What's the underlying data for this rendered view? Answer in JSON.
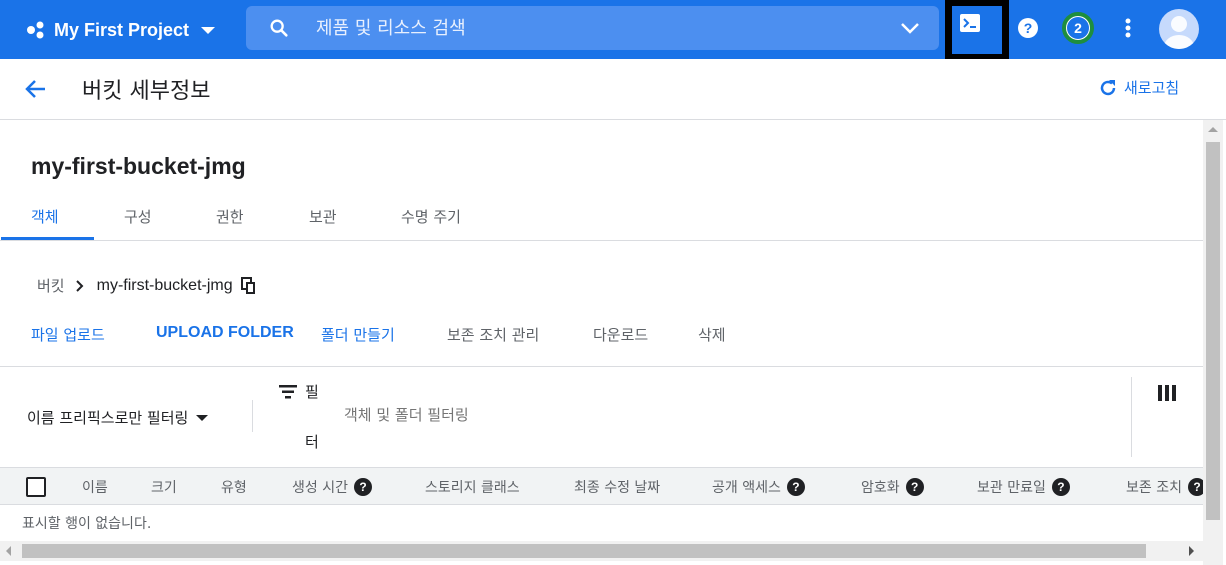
{
  "topbar": {
    "project_name": "My First Project",
    "search_placeholder": "제품 및 리소스 검색",
    "notification_count": "2",
    "help_icon": "help-icon",
    "shell_icon": "cloud-shell-icon",
    "more_icon": "more-vert-icon",
    "accent_color": "#1a73e8"
  },
  "header": {
    "title": "버킷 세부정보",
    "refresh_label": "새로고침"
  },
  "bucket": {
    "name": "my-first-bucket-jmg"
  },
  "tabs": [
    {
      "label": "객체",
      "active": true
    },
    {
      "label": "구성"
    },
    {
      "label": "권한"
    },
    {
      "label": "보관"
    },
    {
      "label": "수명 주기"
    }
  ],
  "breadcrumb": {
    "root": "버킷",
    "current": "my-first-bucket-jmg"
  },
  "actions": {
    "upload_file": "파일 업로드",
    "upload_folder": "UPLOAD FOLDER",
    "create_folder": "폴더 만들기",
    "manage_holds": "보존 조치 관리",
    "download": "다운로드",
    "delete": "삭제"
  },
  "filter": {
    "prefix_label": "이름 프리픽스로만 필터링",
    "filter_label_1": "필",
    "filter_label_2": "터",
    "placeholder": "객체 및 폴더 필터링"
  },
  "table": {
    "columns": [
      "이름",
      "크기",
      "유형",
      "생성 시간",
      "스토리지 클래스",
      "최종 수정 날짜",
      "공개 액세스",
      "암호화",
      "보관 만료일",
      "보존 조치"
    ],
    "empty_message": "표시할 행이 없습니다."
  }
}
